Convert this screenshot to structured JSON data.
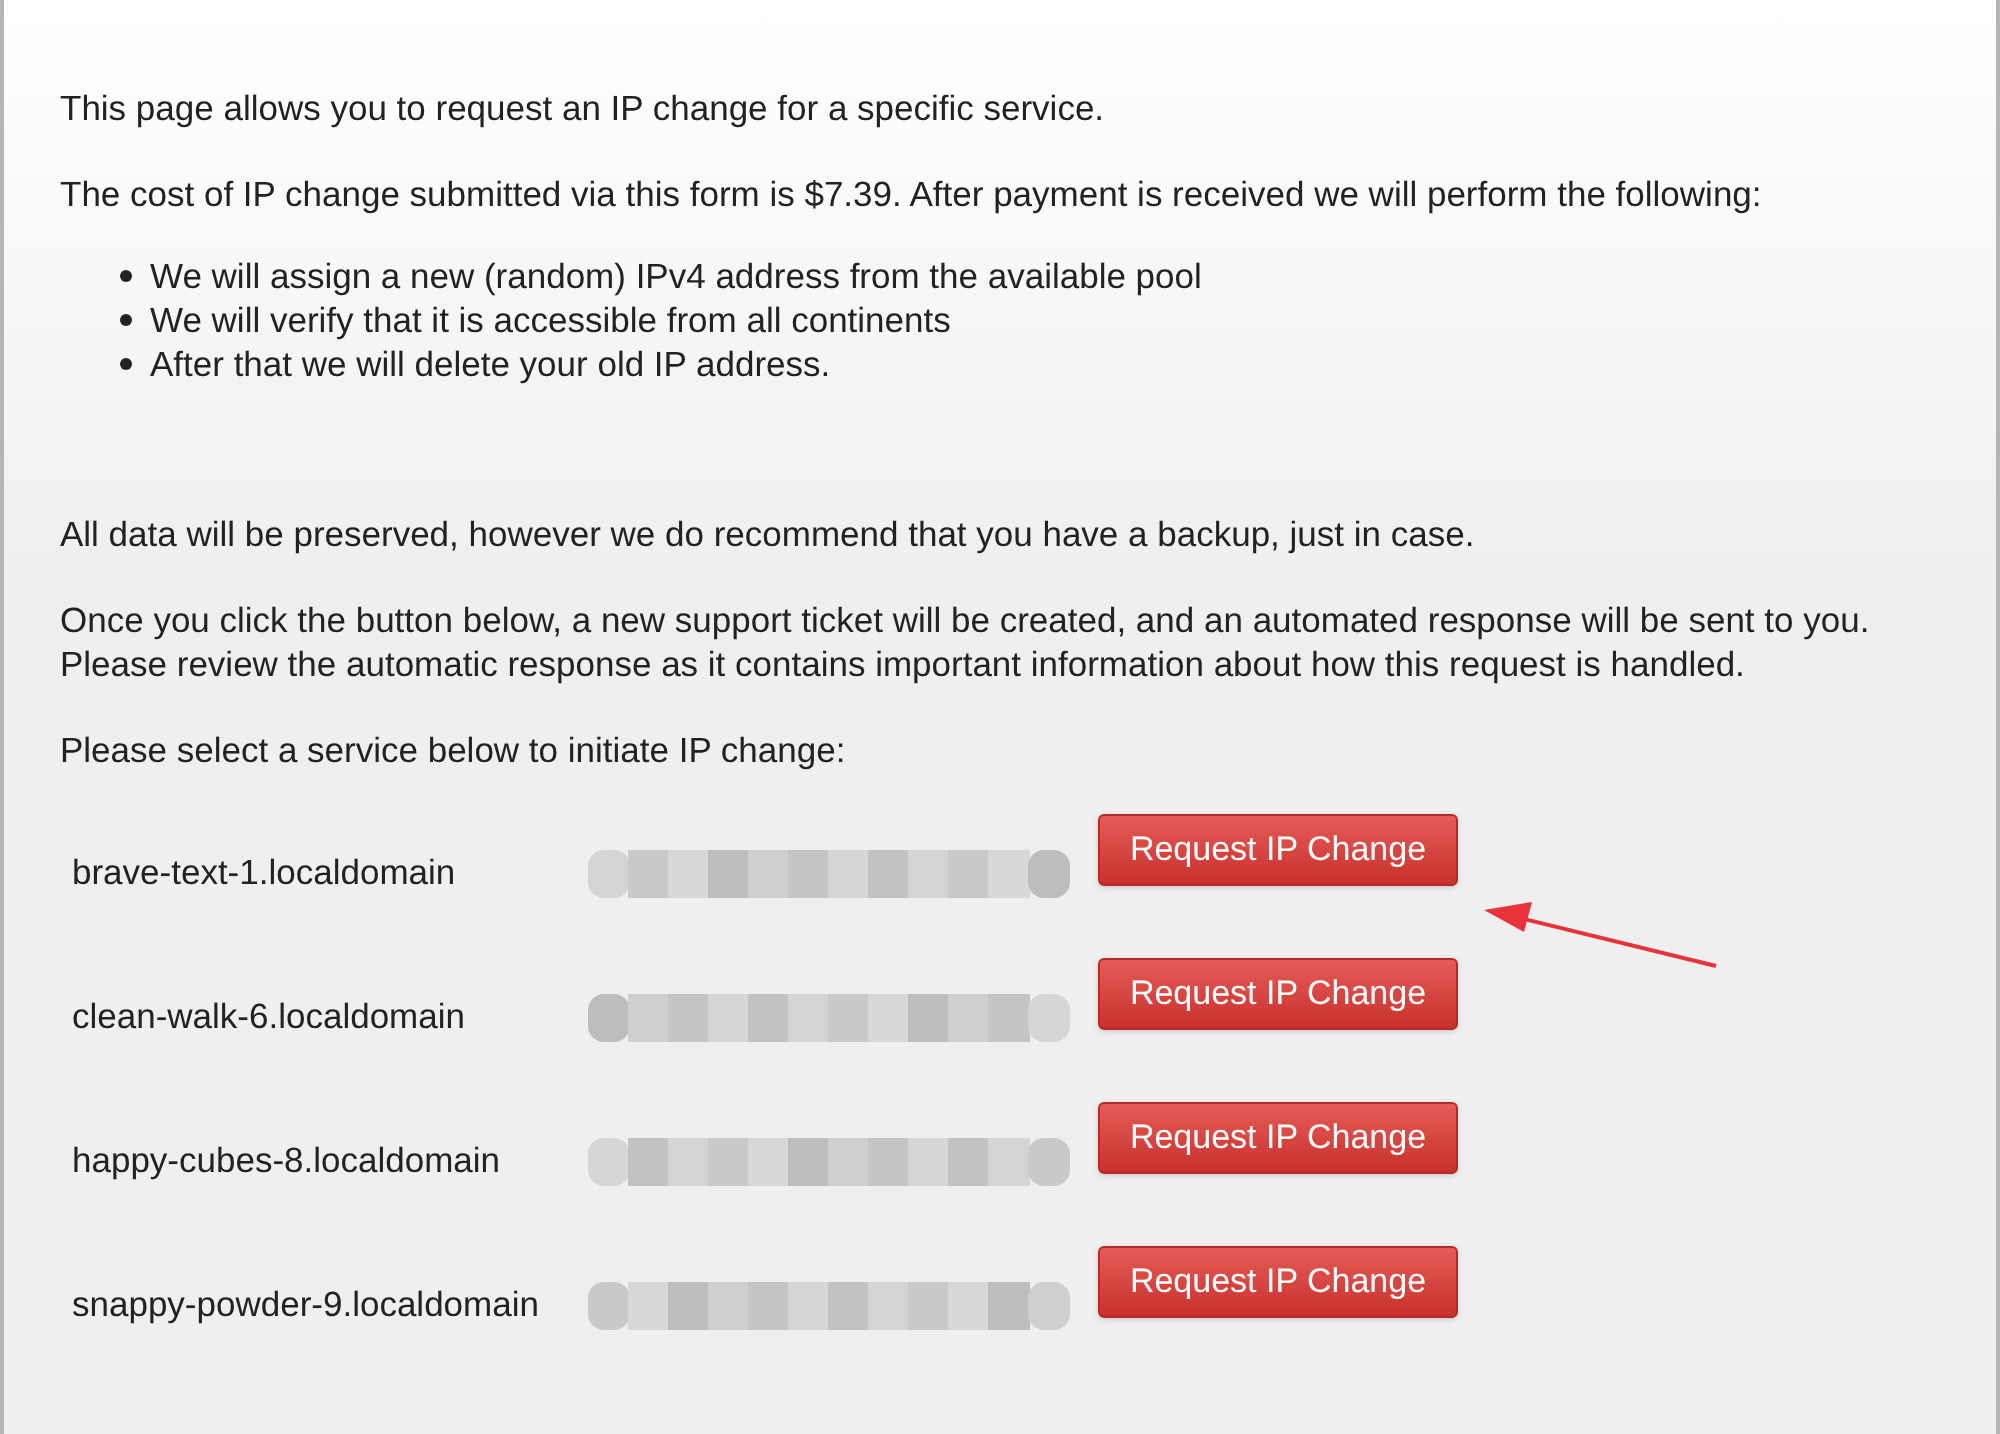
{
  "intro": "This page allows you to request an IP change for a specific service.",
  "cost_text": "The cost of IP change submitted via this form is $7.39. After payment is received we will perform the following:",
  "steps": [
    "We will assign a new (random) IPv4 address from the available pool",
    "We will verify that it is accessible from all continents",
    "After that we will delete your old IP address."
  ],
  "data_note": "All data will be preserved, however we do recommend that you have a backup, just in case.",
  "ticket_note": "Once you click the button below, a new support ticket will be created, and an automated response will be sent to you. Please review the automatic response as it contains important information about how this request is handled.",
  "select_prompt": "Please select a service below to initiate IP change:",
  "services": [
    {
      "hostname": "brave-text-1.localdomain",
      "button": "Request IP Change"
    },
    {
      "hostname": "clean-walk-6.localdomain",
      "button": "Request IP Change"
    },
    {
      "hostname": "happy-cubes-8.localdomain",
      "button": "Request IP Change"
    },
    {
      "hostname": "snappy-powder-9.localdomain",
      "button": "Request IP Change"
    }
  ]
}
